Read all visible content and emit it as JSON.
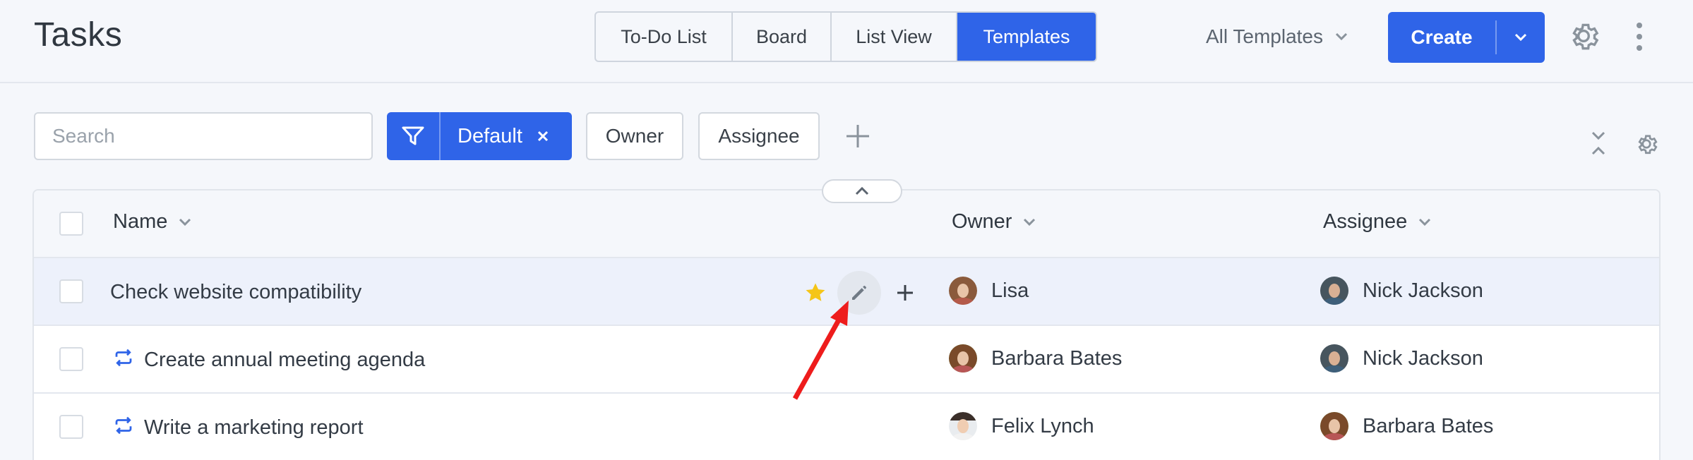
{
  "header": {
    "title": "Tasks",
    "views": [
      {
        "label": "To-Do List",
        "active": false
      },
      {
        "label": "Board",
        "active": false
      },
      {
        "label": "List View",
        "active": false
      },
      {
        "label": "Templates",
        "active": true
      }
    ],
    "template_filter": "All Templates",
    "create_label": "Create"
  },
  "filters": {
    "search_placeholder": "Search",
    "active_filter": "Default",
    "chips": [
      "Owner",
      "Assignee"
    ]
  },
  "table": {
    "columns": {
      "name": "Name",
      "owner": "Owner",
      "assignee": "Assignee"
    },
    "rows": [
      {
        "name": "Check website compatibility",
        "recurring": false,
        "starred": true,
        "owner": "Lisa",
        "assignee": "Nick Jackson"
      },
      {
        "name": "Create annual meeting agenda",
        "recurring": true,
        "starred": false,
        "owner": "Barbara Bates",
        "assignee": "Nick Jackson"
      },
      {
        "name": "Write a marketing report",
        "recurring": true,
        "starred": false,
        "owner": "Felix Lynch",
        "assignee": "Barbara Bates"
      }
    ]
  },
  "colors": {
    "accent": "#2f64e8",
    "star": "#f5c518",
    "annotation_arrow": "#ee1c1c"
  },
  "icons": [
    "chevron-down-icon",
    "gear-icon",
    "more-vertical-icon",
    "filter-icon",
    "close-icon",
    "plus-icon",
    "collapse-icon",
    "chevron-up-icon",
    "star-icon",
    "pencil-icon",
    "repeat-icon"
  ]
}
